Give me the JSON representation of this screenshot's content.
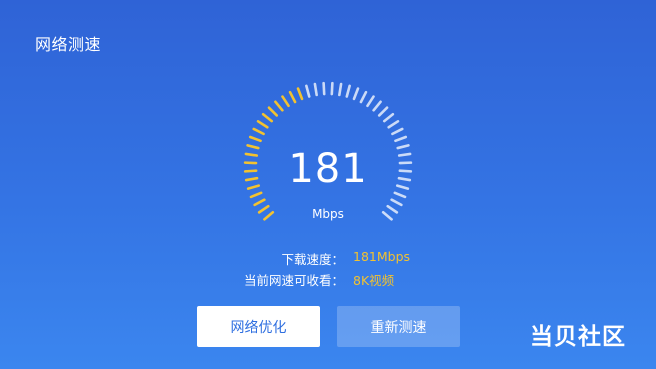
{
  "header": {
    "title": "网络测速"
  },
  "gauge": {
    "value": "181",
    "unit": "Mbps",
    "progress_fraction": 0.43,
    "colors": {
      "active": "#f2c230",
      "inactive": "#ffffff"
    }
  },
  "info": {
    "download_label": "下载速度：",
    "download_value": "181Mbps",
    "video_label": "当前网速可收看：",
    "video_value": "8K视频"
  },
  "buttons": {
    "optimize": "网络优化",
    "retest": "重新测速"
  },
  "brand": {
    "text": "当贝社区"
  }
}
